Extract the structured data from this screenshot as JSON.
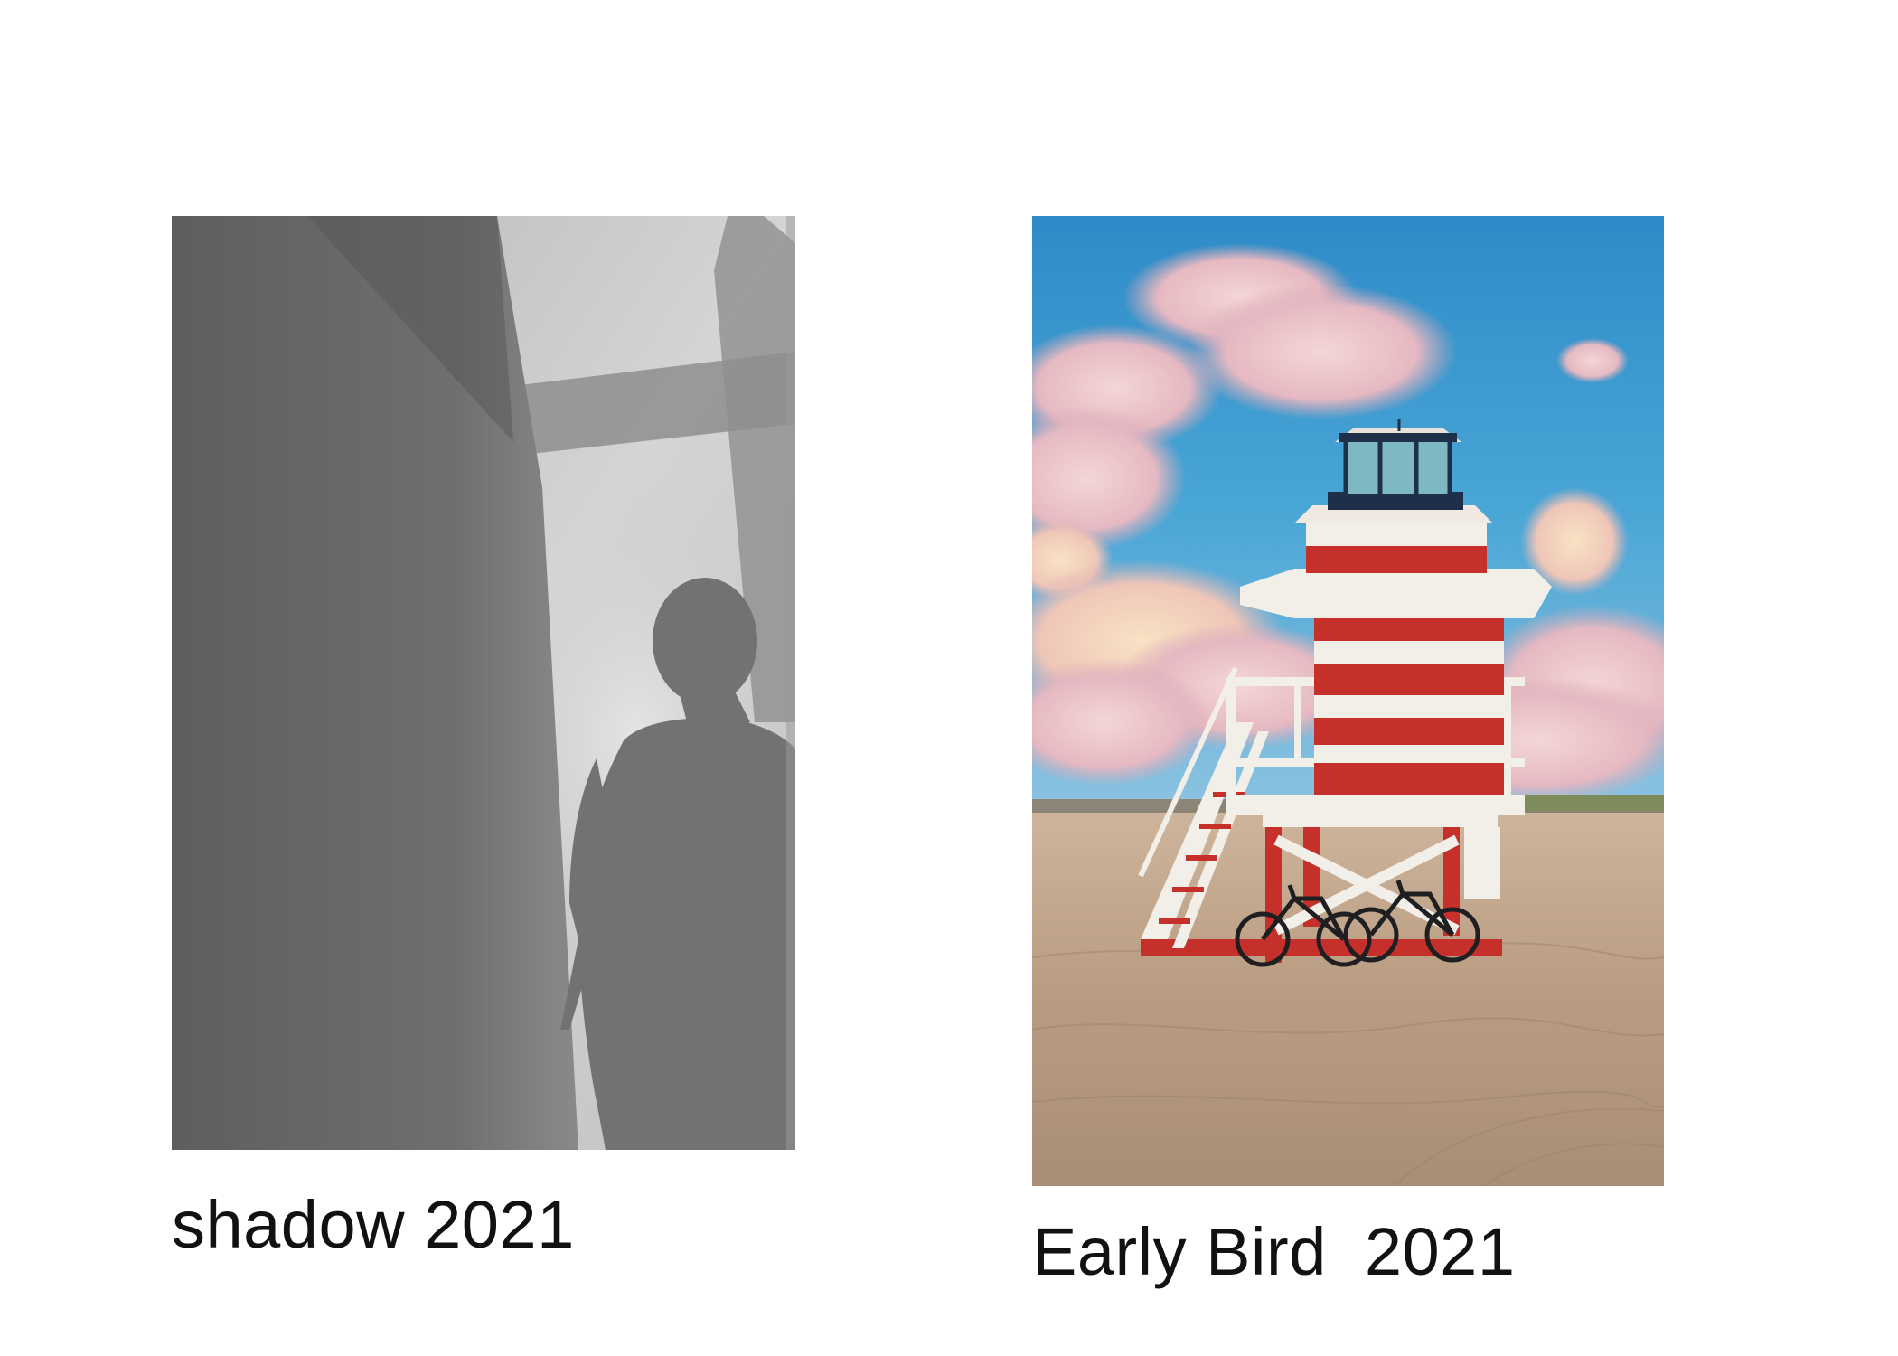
{
  "artworks": [
    {
      "caption": "shadow 2021",
      "subject": "black-and-white shadow silhouette of a person against a wall with window-frame shadow"
    },
    {
      "caption": "Early Bird  2021",
      "subject": "red-and-white striped lifeguard tower on a beach with bicycles, blue sky and pink clouds"
    }
  ]
}
